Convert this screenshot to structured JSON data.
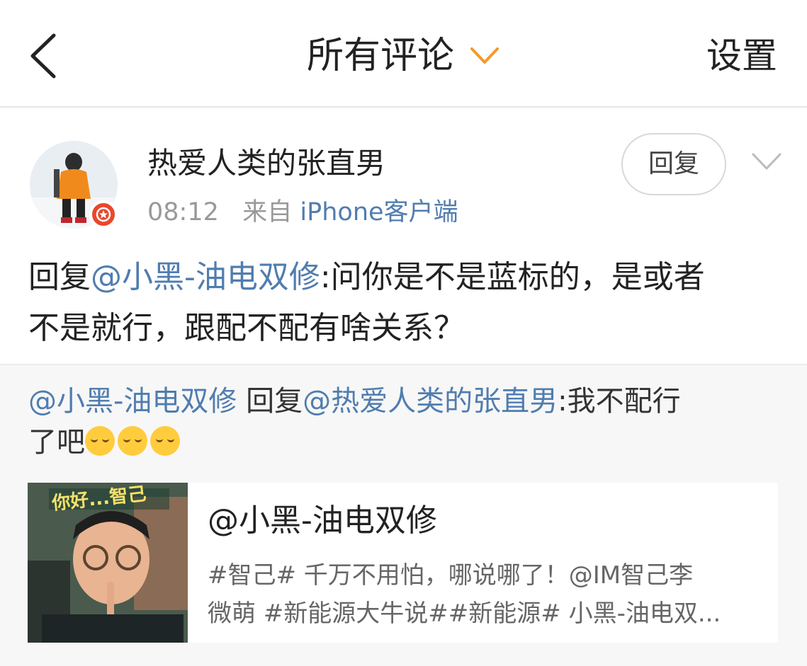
{
  "header": {
    "back_icon": "chevron-left-icon",
    "title": "所有评论",
    "title_chevron_icon": "chevron-down-icon",
    "settings_label": "设置",
    "accent_color": "#f39a29"
  },
  "comment": {
    "username": "热爱人类的张直男",
    "time": "08:12",
    "source_prefix": "来自",
    "source": "iPhone客户端",
    "reply_button_label": "回复",
    "menu_icon": "chevron-down-icon",
    "text": {
      "prefix": "回复",
      "mention": "@小黑-油电双修",
      "line1_rest": ":问你是不是蓝标的，是或者",
      "line2": "不是就行，跟配不配有啥关系？"
    }
  },
  "nested_reply": {
    "author": "@小黑-油电双修",
    "reply_word": " 回复",
    "target": "@热爱人类的张直男",
    "line1_rest": ":我不配行",
    "line2": "了吧",
    "emoji_icon": "crying-face-icon"
  },
  "card": {
    "thumbnail_caption": "你好...智己",
    "title": "@小黑-油电双修",
    "desc_line1": "#智己# 千万不用怕，哪说哪了！@IM智己李",
    "desc_line2": "微萌 #新能源大牛说##新能源# 小黑-油电双..."
  },
  "colors": {
    "link": "#507daf",
    "muted": "#999999",
    "badge": "#e9472d"
  }
}
